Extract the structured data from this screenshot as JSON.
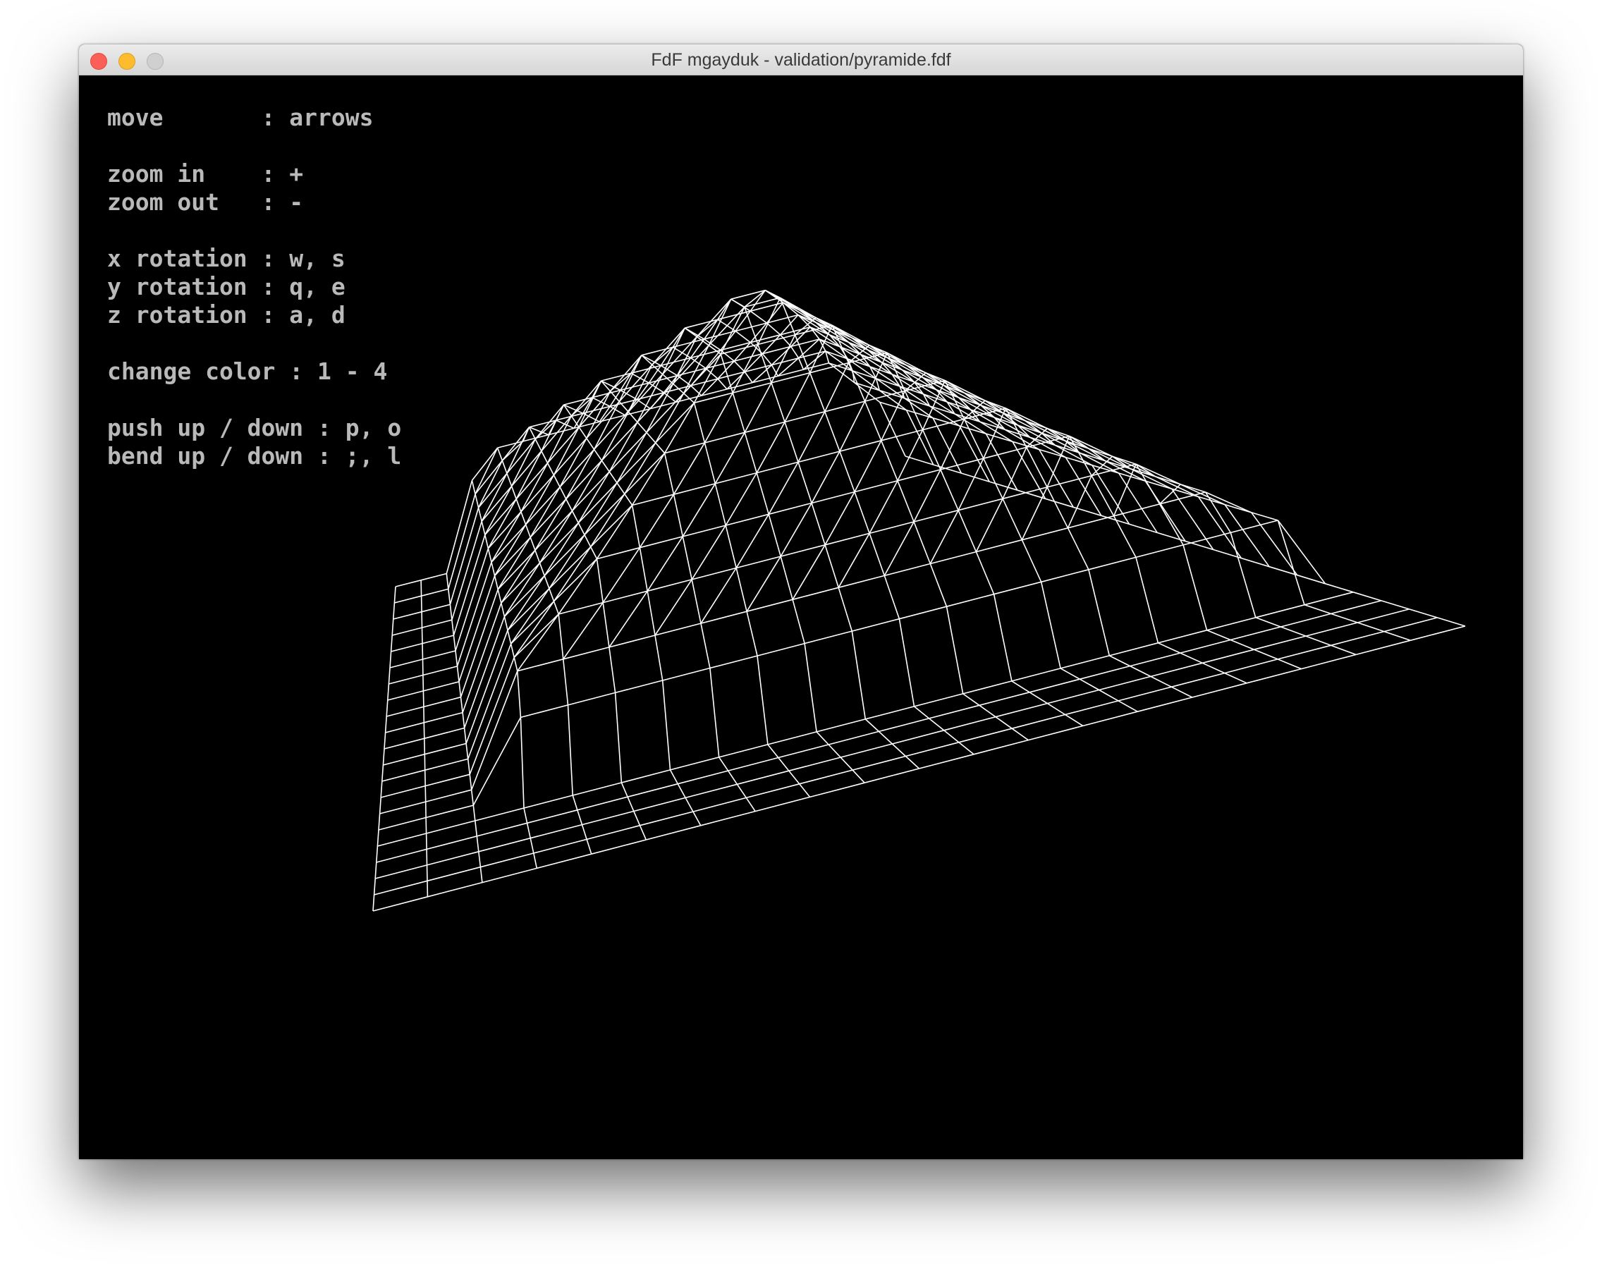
{
  "window": {
    "title": "FdF mgayduk - validation/pyramide.fdf"
  },
  "help": {
    "move": "move       : arrows",
    "zoom_in": "zoom in    : +",
    "zoom_out": "zoom out   : -",
    "x_rotation": "x rotation : w, s",
    "y_rotation": "y rotation : q, e",
    "z_rotation": "z rotation : a, d",
    "change_color": "change color : 1 - 4",
    "push": "push up / down : p, o",
    "bend": "bend up / down : ;, l"
  },
  "render": {
    "line_color": "#ffffff",
    "background": "#000000"
  }
}
